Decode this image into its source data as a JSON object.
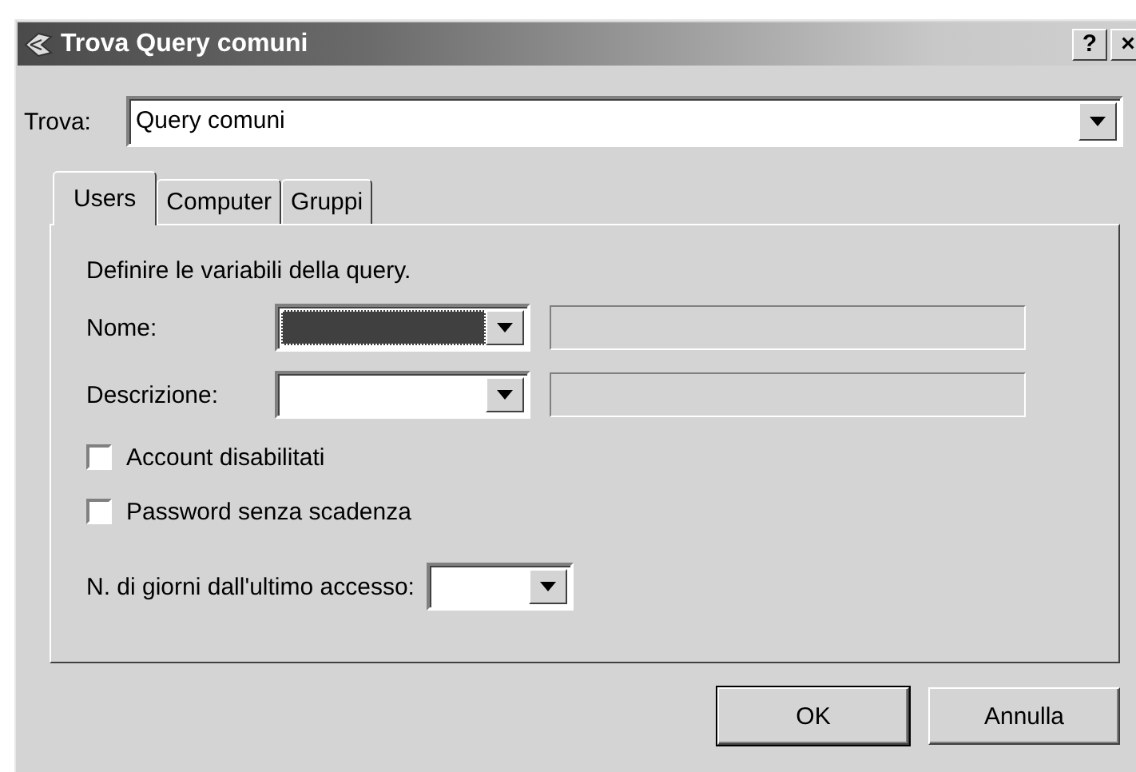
{
  "window": {
    "title": "Trova Query comuni",
    "buttons": [
      "?",
      "×"
    ]
  },
  "find": {
    "label": "Trova:",
    "value": "Query comuni"
  },
  "tabs": [
    {
      "label": "Users",
      "selected": true
    },
    {
      "label": "Computer",
      "selected": false
    },
    {
      "label": "Gruppi",
      "selected": false
    }
  ],
  "intro": "Definire le variabili della query.",
  "fields": [
    {
      "label": "Nome:",
      "focused": true,
      "value_disabled": true
    },
    {
      "label": "Descrizione:",
      "focused": false,
      "value_disabled": true
    }
  ],
  "checkboxes": [
    {
      "label": "Account disabilitati",
      "checked": false
    },
    {
      "label": "Password senza scadenza",
      "checked": false
    }
  ],
  "days": {
    "label": "N. di giorni dall'ultimo accesso:"
  },
  "buttons": [
    {
      "label": "OK",
      "default": true
    },
    {
      "label": "Annulla",
      "default": false
    }
  ]
}
